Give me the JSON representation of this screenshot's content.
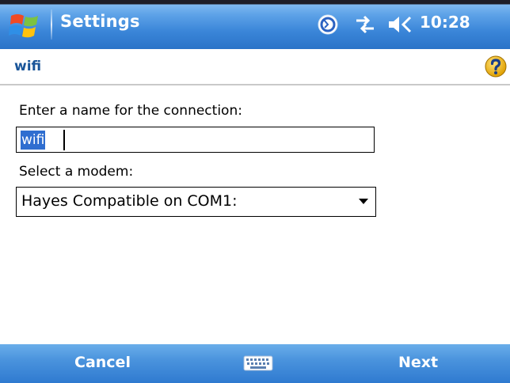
{
  "titlebar": {
    "app_title": "Settings",
    "time": "10:28",
    "icons": [
      "windows-start-icon",
      "sync-icon",
      "connectivity-icon",
      "speaker-icon"
    ]
  },
  "header": {
    "page_title": "wifi",
    "help_icon": "help-icon"
  },
  "form": {
    "name_label": "Enter a name for the connection:",
    "name_value": "wifi",
    "modem_label": "Select a modem:",
    "modem_value": "Hayes Compatible on COM1:"
  },
  "softkeys": {
    "left": "Cancel",
    "right": "Next",
    "center_icon": "keyboard-icon"
  },
  "colors": {
    "titlebar": "#3a85d8",
    "page_title": "#1a5599",
    "selection": "#2f6ed0",
    "softbar": "#4a93dd"
  }
}
